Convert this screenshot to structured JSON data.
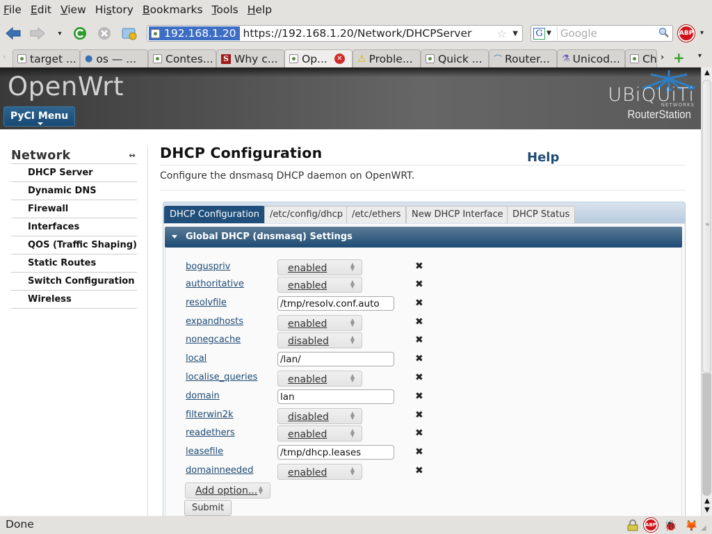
{
  "browser": {
    "menu": [
      {
        "label": "File",
        "accel": "F"
      },
      {
        "label": "Edit",
        "accel": "E"
      },
      {
        "label": "View",
        "accel": "V"
      },
      {
        "label": "History",
        "accel": "s"
      },
      {
        "label": "Bookmarks",
        "accel": "B"
      },
      {
        "label": "Tools",
        "accel": "T"
      },
      {
        "label": "Help",
        "accel": "H"
      }
    ],
    "menu_labels": [
      "File",
      "Edit",
      "View",
      "History",
      "Bookmarks",
      "Tools",
      "Help"
    ],
    "url_site": "192.168.1.20",
    "url": "https://192.168.1.20/Network/DHCPServer",
    "search_placeholder": "Google",
    "search_engine_icon": "G",
    "abp_label": "ABP",
    "tabs": [
      {
        "label": "target ...",
        "icon": "page-icon"
      },
      {
        "label": "os — ...",
        "icon": "python-icon"
      },
      {
        "label": "Contes...",
        "icon": "page-icon"
      },
      {
        "label": "Why c...",
        "icon": "s-icon"
      },
      {
        "label": "Op...",
        "icon": "page-icon",
        "active": true
      },
      {
        "label": "Proble...",
        "icon": "warning-icon"
      },
      {
        "label": "Quick ...",
        "icon": "page-icon"
      },
      {
        "label": "Router...",
        "icon": "ubiquiti-icon"
      },
      {
        "label": "Unicod...",
        "icon": "unicode-icon"
      },
      {
        "label": "Ch",
        "icon": "page-icon"
      }
    ],
    "status": "Done"
  },
  "header": {
    "brand": "OpenWrt",
    "menu_button": "PyCI Menu",
    "vendor_word": "UBiQUiTi",
    "vendor_sub": "NETWORKS",
    "product": "RouterStation"
  },
  "sidebar": {
    "heading": "Network",
    "toggle_icon": "↔",
    "items": [
      "DHCP Server",
      "Dynamic DNS",
      "Firewall",
      "Interfaces",
      "QOS (Traffic Shaping)",
      "Static Routes",
      "Switch Configuration",
      "Wireless"
    ]
  },
  "main": {
    "title": "DHCP Configuration",
    "help": "Help",
    "description": "Configure the dnsmasq DHCP daemon on OpenWRT.",
    "tabs": [
      {
        "label": "DHCP Configuration",
        "active": true
      },
      {
        "label": "/etc/config/dhcp"
      },
      {
        "label": "/etc/ethers"
      },
      {
        "label": "New DHCP Interface"
      },
      {
        "label": "DHCP Status"
      }
    ],
    "section_title": "Global DHCP (dnsmasq) Settings",
    "options": [
      {
        "name": "boguspriv",
        "type": "select",
        "value": "enabled"
      },
      {
        "name": "authoritative",
        "type": "select",
        "value": "enabled"
      },
      {
        "name": "resolvfile",
        "type": "text",
        "value": "/tmp/resolv.conf.auto"
      },
      {
        "name": "expandhosts",
        "type": "select",
        "value": "enabled"
      },
      {
        "name": "nonegcache",
        "type": "select",
        "value": "disabled"
      },
      {
        "name": "local",
        "type": "text",
        "value": "/lan/"
      },
      {
        "name": "localise_queries",
        "type": "select",
        "value": "enabled"
      },
      {
        "name": "domain",
        "type": "text",
        "value": "lan"
      },
      {
        "name": "filterwin2k",
        "type": "select",
        "value": "disabled"
      },
      {
        "name": "readethers",
        "type": "select",
        "value": "enabled"
      },
      {
        "name": "leasefile",
        "type": "text",
        "value": "/tmp/dhcp.leases"
      },
      {
        "name": "domainneeded",
        "type": "select",
        "value": "enabled"
      }
    ],
    "remove_icon": "✖",
    "add_option": "Add option...",
    "submit": "Submit"
  }
}
